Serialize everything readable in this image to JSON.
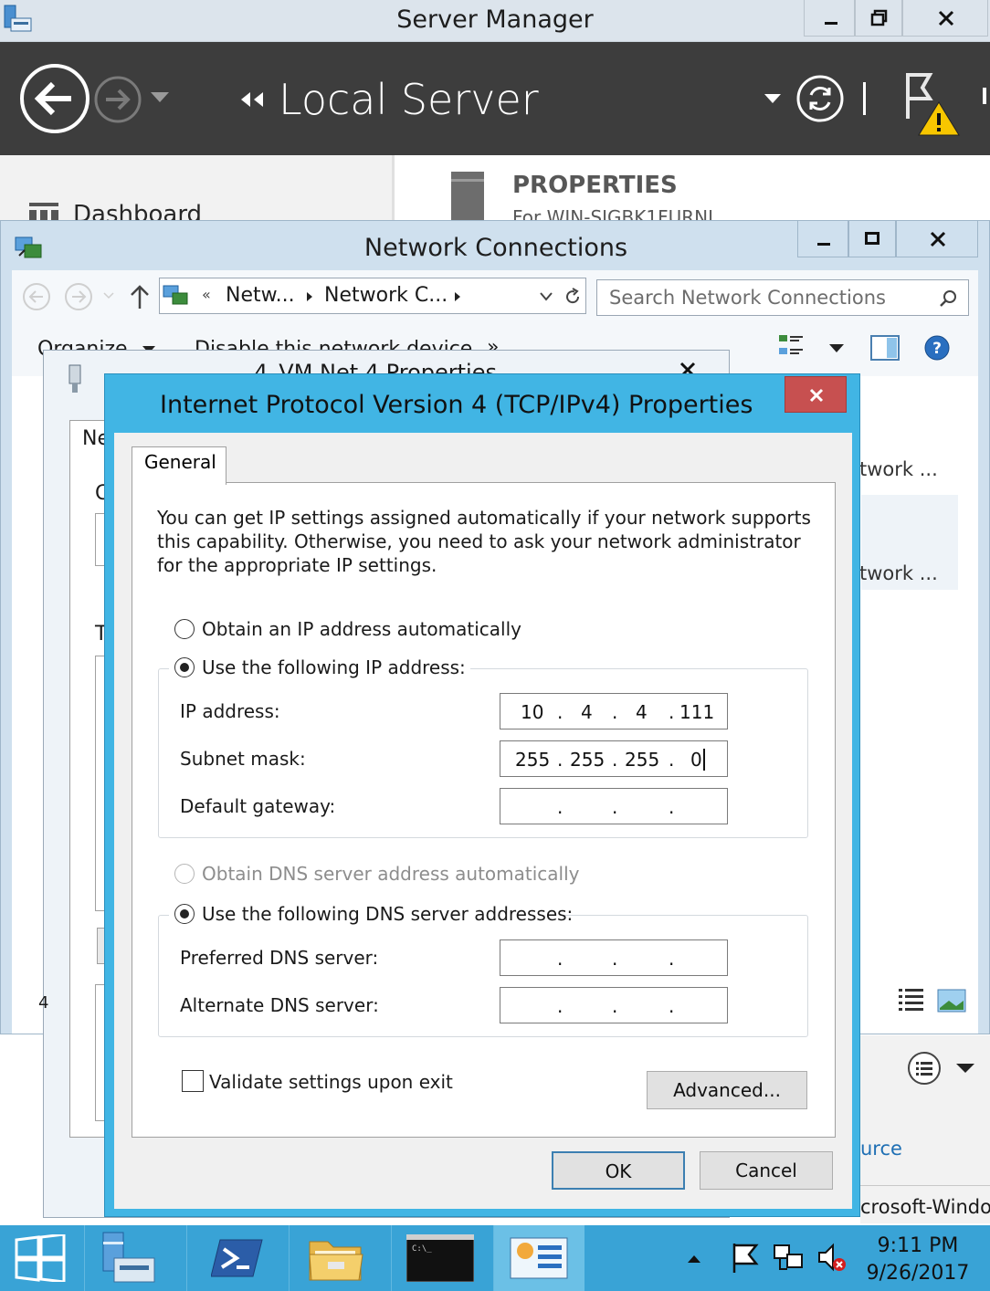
{
  "server_manager": {
    "title": "Server Manager",
    "breadcrumb": "Local Server",
    "nav_item": "Dashboard",
    "section_title": "PROPERTIES",
    "section_sub": "For WIN-SIGBK1FURNI"
  },
  "network_connections": {
    "title": "Network Connections",
    "address_parts": [
      "Netw...",
      "Network C..."
    ],
    "search_placeholder": "Search Network Connections",
    "toolbar": {
      "organize": "Organize",
      "disable": "Disable this network device",
      "more": "»"
    },
    "items": [
      "twork ...",
      "twork ..."
    ],
    "side_text_1": "urce",
    "side_text_2": "crosoft-Windo"
  },
  "vm_properties": {
    "title": "4_VM Net 4 Properties",
    "tab_partial": "Ne",
    "label_c": "C",
    "label_t": "T",
    "number": "4"
  },
  "ipv4": {
    "title": "Internet Protocol Version 4 (TCP/IPv4) Properties",
    "tab": "General",
    "desc_line1": "You can get IP settings assigned automatically if your network supports",
    "desc_line2": "this capability. Otherwise, you need to ask your network administrator",
    "desc_line3": "for the appropriate IP settings.",
    "radio_auto_ip": "Obtain an IP address automatically",
    "radio_manual_ip": "Use the following IP address:",
    "ip_label": "IP address:",
    "ip_octets": [
      "10",
      "4",
      "4",
      "111"
    ],
    "mask_label": "Subnet mask:",
    "mask_octets": [
      "255",
      "255",
      "255",
      "0"
    ],
    "gateway_label": "Default gateway:",
    "radio_auto_dns": "Obtain DNS server address automatically",
    "radio_manual_dns": "Use the following DNS server addresses:",
    "pref_dns_label": "Preferred DNS server:",
    "alt_dns_label": "Alternate DNS server:",
    "validate_label": "Validate settings upon exit",
    "advanced_button": "Advanced...",
    "ok_button": "OK",
    "cancel_button": "Cancel"
  },
  "taskbar": {
    "time": "9:11 PM",
    "date": "9/26/2017"
  }
}
